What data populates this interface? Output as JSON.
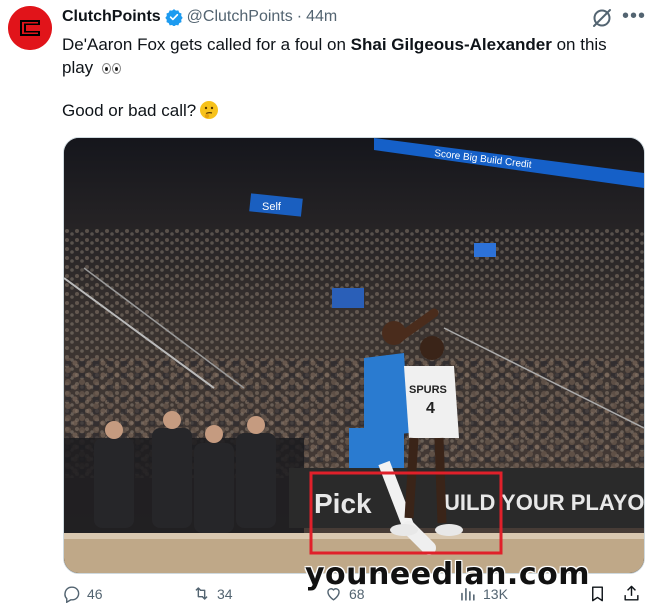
{
  "tweet": {
    "author_name": "ClutchPoints",
    "author_handle": "@ClutchPoints",
    "separator": "·",
    "timestamp": "44m",
    "more_label": "•••",
    "text_part1": "De'Aaron Fox gets called for a foul on ",
    "text_bold": "Shai Gilgeous-Alexander",
    "text_part2": " on this",
    "text_line2": "play",
    "question": "Good or bad call?"
  },
  "media": {
    "jersey_team": "SPURS",
    "jersey_number": "4",
    "ribbon_text": "Score Big  Build Credit",
    "sign_left": "Self",
    "courtside_left": "Pick",
    "courtside_right": "UILD YOUR PLAYOFFS STREAM"
  },
  "actions": {
    "replies": "46",
    "reposts": "34",
    "likes": "68",
    "views": "13K"
  },
  "watermark": "youneedlan.com",
  "colors": {
    "brand_red": "#e1141a",
    "verified_blue": "#1d9bf0",
    "muted": "#536471",
    "highlight_box": "#e0202a"
  },
  "icons": [
    "verified-badge-icon",
    "grok-icon",
    "more-icon",
    "reply-icon",
    "repost-icon",
    "like-icon",
    "views-icon",
    "bookmark-icon",
    "share-icon"
  ]
}
